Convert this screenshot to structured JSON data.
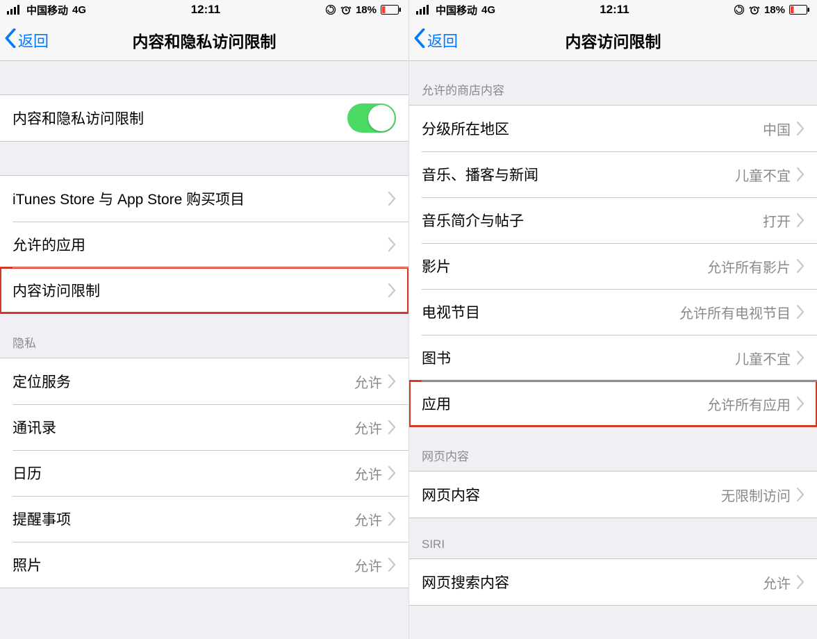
{
  "status": {
    "carrier": "中国移动",
    "network": "4G",
    "time": "12:11",
    "battery_pct": "18%"
  },
  "left": {
    "back_label": "返回",
    "title": "内容和隐私访问限制",
    "toggle_row_label": "内容和隐私访问限制",
    "rows_main": [
      {
        "label": "iTunes Store 与 App Store 购买项目"
      },
      {
        "label": "允许的应用"
      },
      {
        "label": "内容访问限制",
        "highlight": true
      }
    ],
    "privacy_header": "隐私",
    "rows_privacy": [
      {
        "label": "定位服务",
        "value": "允许"
      },
      {
        "label": "通讯录",
        "value": "允许"
      },
      {
        "label": "日历",
        "value": "允许"
      },
      {
        "label": "提醒事项",
        "value": "允许"
      },
      {
        "label": "照片",
        "value": "允许"
      }
    ]
  },
  "right": {
    "back_label": "返回",
    "title": "内容访问限制",
    "store_header": "允许的商店内容",
    "rows_store": [
      {
        "label": "分级所在地区",
        "value": "中国"
      },
      {
        "label": "音乐、播客与新闻",
        "value": "儿童不宜"
      },
      {
        "label": "音乐简介与帖子",
        "value": "打开"
      },
      {
        "label": "影片",
        "value": "允许所有影片"
      },
      {
        "label": "电视节目",
        "value": "允许所有电视节目"
      },
      {
        "label": "图书",
        "value": "儿童不宜"
      },
      {
        "label": "应用",
        "value": "允许所有应用",
        "highlight": true
      }
    ],
    "web_header": "网页内容",
    "rows_web": [
      {
        "label": "网页内容",
        "value": "无限制访问"
      }
    ],
    "siri_header": "SIRI",
    "rows_siri": [
      {
        "label": "网页搜索内容",
        "value": "允许"
      }
    ]
  }
}
